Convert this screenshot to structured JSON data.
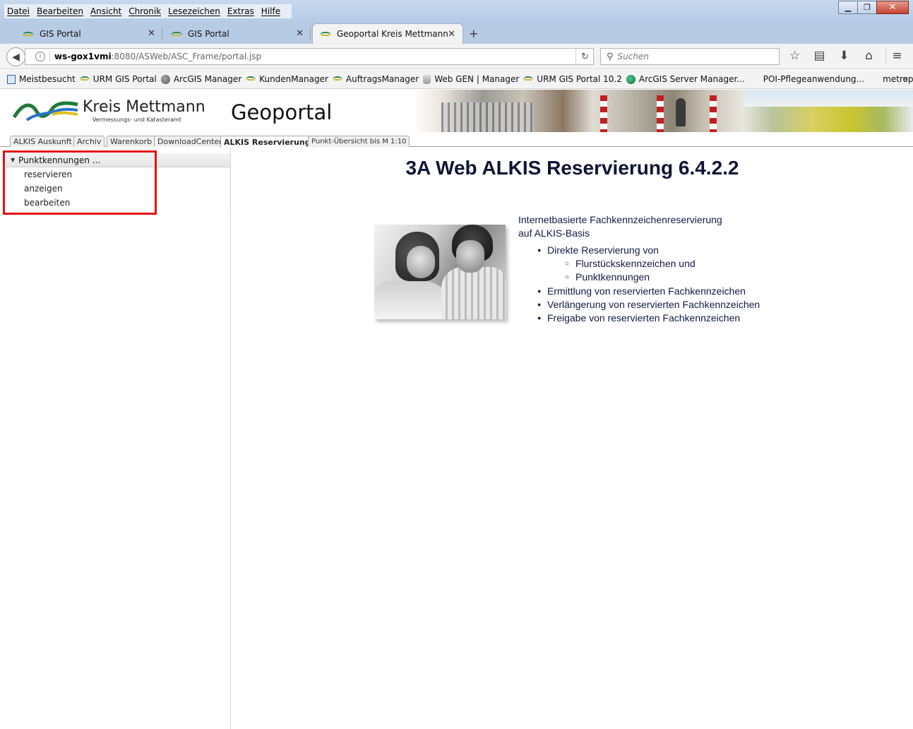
{
  "menu": [
    "Datei",
    "Bearbeiten",
    "Ansicht",
    "Chronik",
    "Lesezeichen",
    "Extras",
    "Hilfe"
  ],
  "tabs": [
    {
      "label": "GIS Portal"
    },
    {
      "label": "GIS Portal"
    },
    {
      "label": "Geoportal Kreis Mettmann"
    }
  ],
  "url": {
    "host": "ws-gox1vmi",
    "rest": ":8080/ASWeb/ASC_Frame/portal.jsp"
  },
  "search": {
    "placeholder": "Suchen"
  },
  "bookmarks": [
    "Meistbesucht",
    "URM GIS Portal",
    "ArcGIS Manager",
    "KundenManager",
    "AuftragsManager",
    "Web GEN | Manager",
    "URM GIS Portal 10.2",
    "ArcGIS Server Manager...",
    "POI-Pflegeanwendung...",
    "metropoleruhr"
  ],
  "header": {
    "brand": "Kreis Mettmann",
    "brand_sub": "Vermessungs- und Katasteramt",
    "title": "Geoportal"
  },
  "app_tabs": [
    "ALKIS Auskunft",
    "Archiv",
    "Warenkorb",
    "DownloadCenter",
    "ALKIS Reservierung",
    "Punkt-Übersicht bis M 1:10"
  ],
  "tree": {
    "header": "Punktkennungen ...",
    "items": [
      "reservieren",
      "anzeigen",
      "bearbeiten"
    ]
  },
  "main": {
    "title": "3A Web ALKIS Reservierung 6.4.2.2",
    "intro_line1": "Internetbasierte Fachkennzeichenreservierung",
    "intro_line2": "auf ALKIS-Basis",
    "bullet1": "Direkte Reservierung von",
    "sub1": "Flurstückskennzeichen und",
    "sub2": "Punktkennungen",
    "bullet2": "Ermittlung von reservierten Fachkennzeichen",
    "bullet3": "Verlängerung von reservierten Fachkennzeichen",
    "bullet4": "Freigabe von reservierten Fachkennzeichen"
  }
}
